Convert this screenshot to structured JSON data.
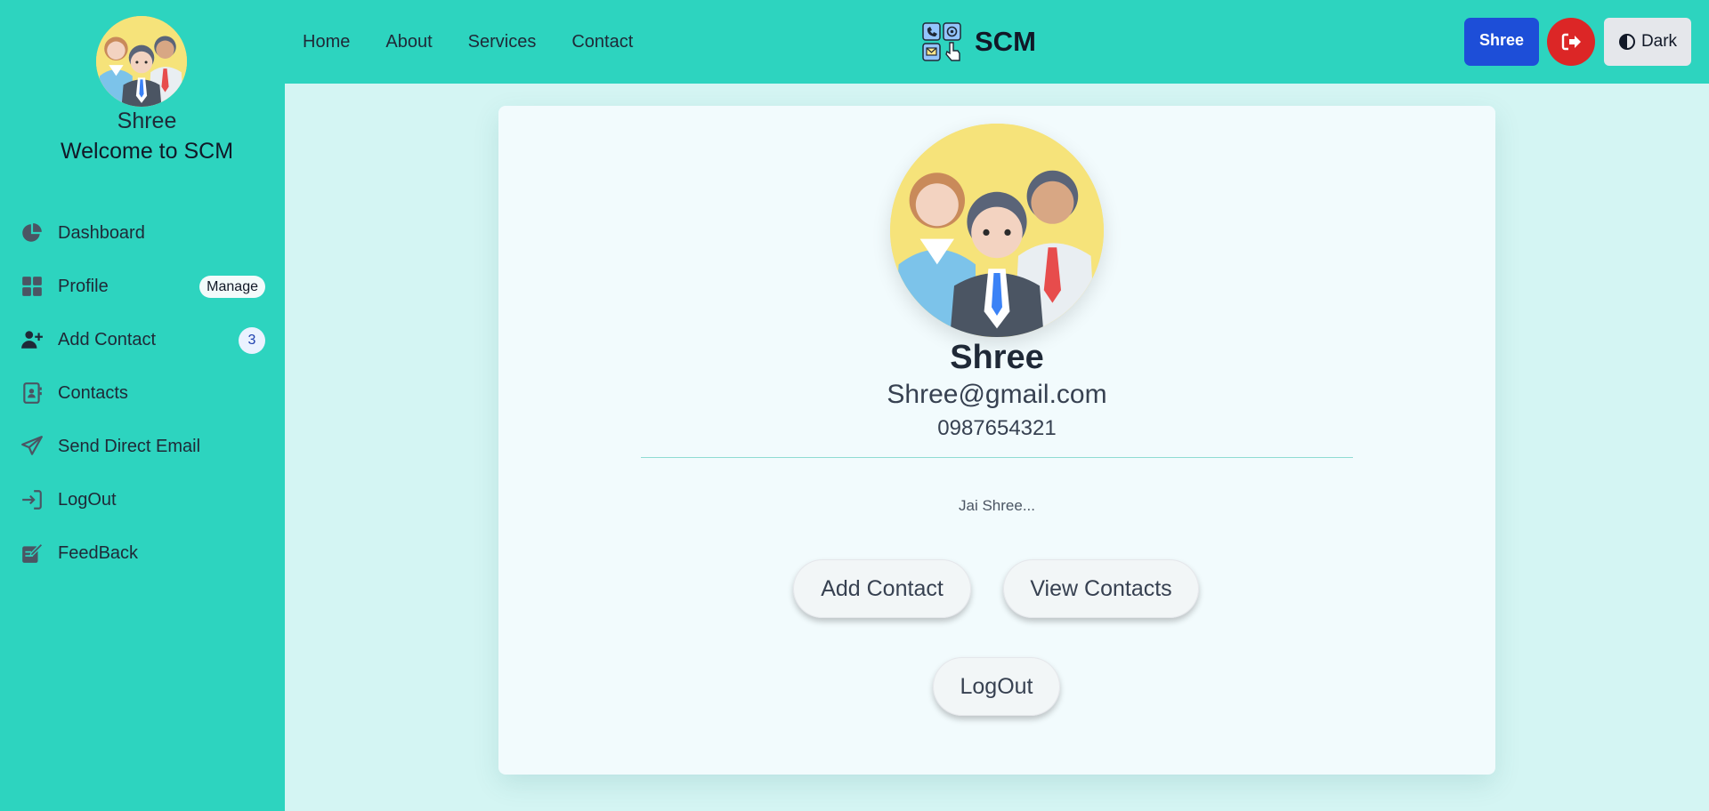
{
  "user": {
    "name": "Shree",
    "email": "Shree@gmail.com",
    "phone": "0987654321",
    "about": "Jai Shree..."
  },
  "sidebar": {
    "username": "Shree",
    "welcome": "Welcome to SCM",
    "items": [
      {
        "label": "Dashboard",
        "icon": "pie-chart-icon"
      },
      {
        "label": "Profile",
        "icon": "grid-icon",
        "badge": "Manage"
      },
      {
        "label": "Add Contact",
        "icon": "user-plus-icon",
        "badge": "3"
      },
      {
        "label": "Contacts",
        "icon": "address-book-icon"
      },
      {
        "label": "Send Direct Email",
        "icon": "paper-plane-icon"
      },
      {
        "label": "LogOut",
        "icon": "sign-in-icon"
      },
      {
        "label": "FeedBack",
        "icon": "edit-icon"
      }
    ]
  },
  "navbar": {
    "links": [
      "Home",
      "About",
      "Services",
      "Contact"
    ],
    "brand": "SCM",
    "user_button": "Shree",
    "theme_button": "Dark"
  },
  "actions": {
    "add_contact": "Add Contact",
    "view_contacts": "View Contacts",
    "logout": "LogOut"
  },
  "colors": {
    "primary": "#2dd4bf",
    "background": "#d4f5f3",
    "user_button": "#1d4ed8",
    "logout_button": "#dc2626"
  }
}
